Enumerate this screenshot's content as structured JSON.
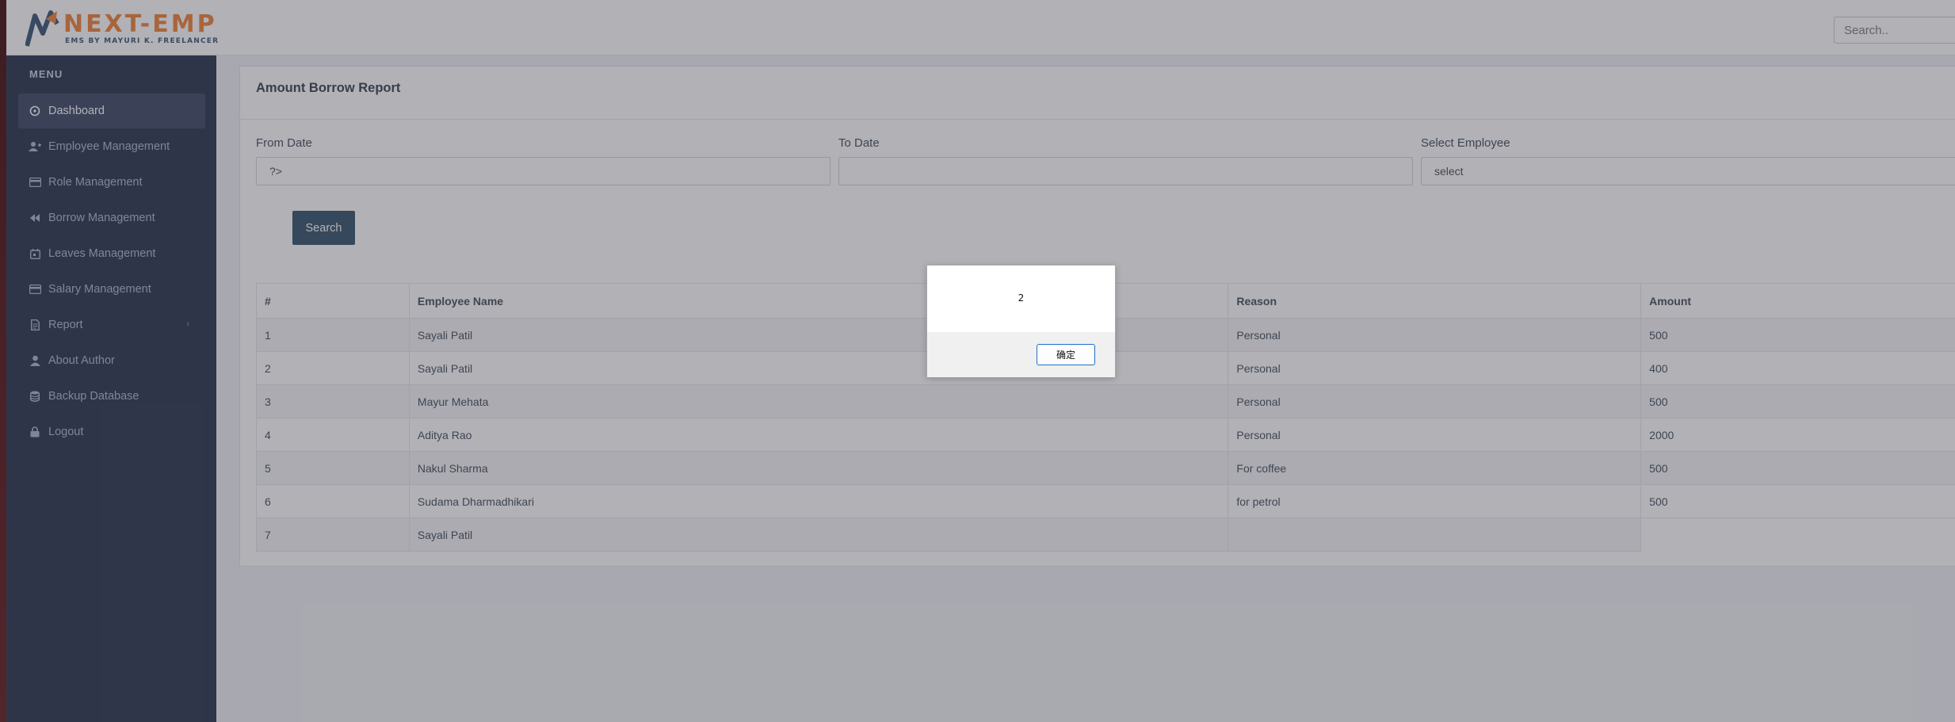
{
  "brand": {
    "title": "NEXT-EMP",
    "subtitle": "EMS BY MAYURI K. FREELANCER"
  },
  "header": {
    "search_placeholder": "Search.."
  },
  "sidebar": {
    "menu_heading": "MENU",
    "items": [
      {
        "label": "Dashboard",
        "icon": "dashboard-icon",
        "active": true
      },
      {
        "label": "Employee Management",
        "icon": "user-plus-icon"
      },
      {
        "label": "Role Management",
        "icon": "card-icon"
      },
      {
        "label": "Borrow Management",
        "icon": "rewind-icon"
      },
      {
        "label": "Leaves Management",
        "icon": "calendar-icon"
      },
      {
        "label": "Salary Management",
        "icon": "credit-card-icon"
      },
      {
        "label": "Report",
        "icon": "document-icon",
        "has_submenu": true
      },
      {
        "label": "About Author",
        "icon": "person-icon"
      },
      {
        "label": "Backup Database",
        "icon": "database-icon"
      },
      {
        "label": "Logout",
        "icon": "lock-icon"
      }
    ]
  },
  "report": {
    "title": "Amount Borrow Report",
    "from_date_label": "From Date",
    "from_date_value": "?>",
    "to_date_label": "To Date",
    "to_date_value": "",
    "employee_label": "Select Employee",
    "employee_value": "select",
    "search_button": "Search",
    "columns": [
      "#",
      "Employee Name",
      "Reason",
      "Amount"
    ],
    "rows": [
      [
        "1",
        "Sayali Patil",
        "Personal",
        "500"
      ],
      [
        "2",
        "Sayali Patil",
        "Personal",
        "400"
      ],
      [
        "3",
        "Mayur Mehata",
        "Personal",
        "500"
      ],
      [
        "4",
        "Aditya Rao",
        "Personal",
        "2000"
      ],
      [
        "5",
        "Nakul Sharma",
        "For coffee",
        "500"
      ],
      [
        "6",
        "Sudama Dharmadhikari",
        "for petrol",
        "500"
      ],
      [
        "7",
        "Sayali Patil",
        "",
        ""
      ]
    ]
  },
  "dialog": {
    "message": "2",
    "ok_button": "确定"
  },
  "colors": {
    "sidebar_bg": "#1f2a44",
    "accent_orange": "#ef7d2e",
    "button_dark": "#2c4a63"
  }
}
